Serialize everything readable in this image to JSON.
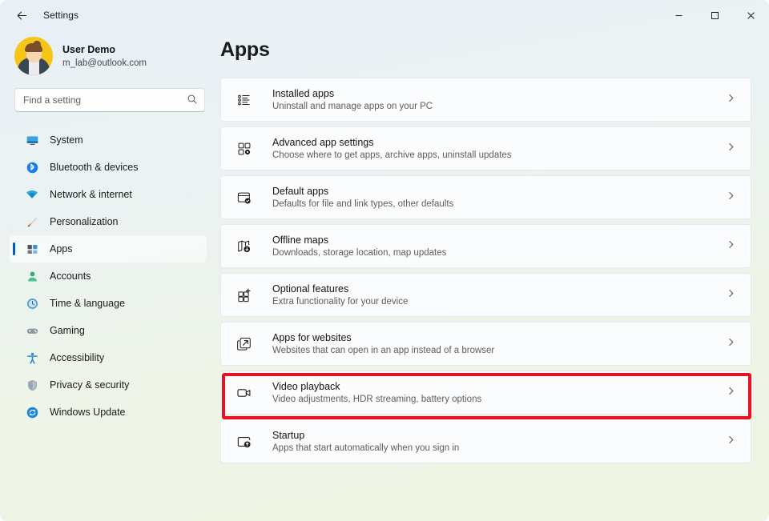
{
  "window": {
    "title": "Settings",
    "back_icon": "back-arrow-icon",
    "controls": {
      "minimize": "–",
      "maximize": "☐",
      "close": "✕"
    }
  },
  "accounts": {
    "name": "User Demo",
    "email": "m_lab@outlook.com"
  },
  "search": {
    "placeholder": "Find a setting",
    "value": ""
  },
  "sidebar": {
    "items": [
      {
        "label": "System",
        "icon": "monitor-icon",
        "active": false
      },
      {
        "label": "Bluetooth & devices",
        "icon": "bluetooth-icon",
        "active": false
      },
      {
        "label": "Network & internet",
        "icon": "wifi-icon",
        "active": false
      },
      {
        "label": "Personalization",
        "icon": "paintbrush-icon",
        "active": false
      },
      {
        "label": "Apps",
        "icon": "apps-grid-icon",
        "active": true
      },
      {
        "label": "Accounts",
        "icon": "person-icon",
        "active": false
      },
      {
        "label": "Time & language",
        "icon": "clock-globe-icon",
        "active": false
      },
      {
        "label": "Gaming",
        "icon": "gamepad-icon",
        "active": false
      },
      {
        "label": "Accessibility",
        "icon": "accessibility-icon",
        "active": false
      },
      {
        "label": "Privacy & security",
        "icon": "shield-icon",
        "active": false
      },
      {
        "label": "Windows Update",
        "icon": "refresh-icon",
        "active": false
      }
    ]
  },
  "main": {
    "page_title": "Apps",
    "cards": [
      {
        "title": "Installed apps",
        "subtitle": "Uninstall and manage apps on your PC",
        "icon": "bullet-list-icon",
        "highlighted": false
      },
      {
        "title": "Advanced app settings",
        "subtitle": "Choose where to get apps, archive apps, uninstall updates",
        "icon": "grid-gear-icon",
        "highlighted": false
      },
      {
        "title": "Default apps",
        "subtitle": "Defaults for file and link types, other defaults",
        "icon": "window-check-icon",
        "highlighted": false
      },
      {
        "title": "Offline maps",
        "subtitle": "Downloads, storage location, map updates",
        "icon": "map-download-icon",
        "highlighted": false
      },
      {
        "title": "Optional features",
        "subtitle": "Extra functionality for your device",
        "icon": "grid-plus-icon",
        "highlighted": false
      },
      {
        "title": "Apps for websites",
        "subtitle": "Websites that can open in an app instead of a browser",
        "icon": "external-link-icon",
        "highlighted": false
      },
      {
        "title": "Video playback",
        "subtitle": "Video adjustments, HDR streaming, battery options",
        "icon": "video-camera-icon",
        "highlighted": true
      },
      {
        "title": "Startup",
        "subtitle": "Apps that start automatically when you sign in",
        "icon": "startup-power-icon",
        "highlighted": false
      }
    ],
    "chevron_icon": "chevron-right-icon"
  },
  "colors": {
    "accent": "#005fb8",
    "annotation": "#e81123",
    "avatar_bg": "#f5c518"
  }
}
